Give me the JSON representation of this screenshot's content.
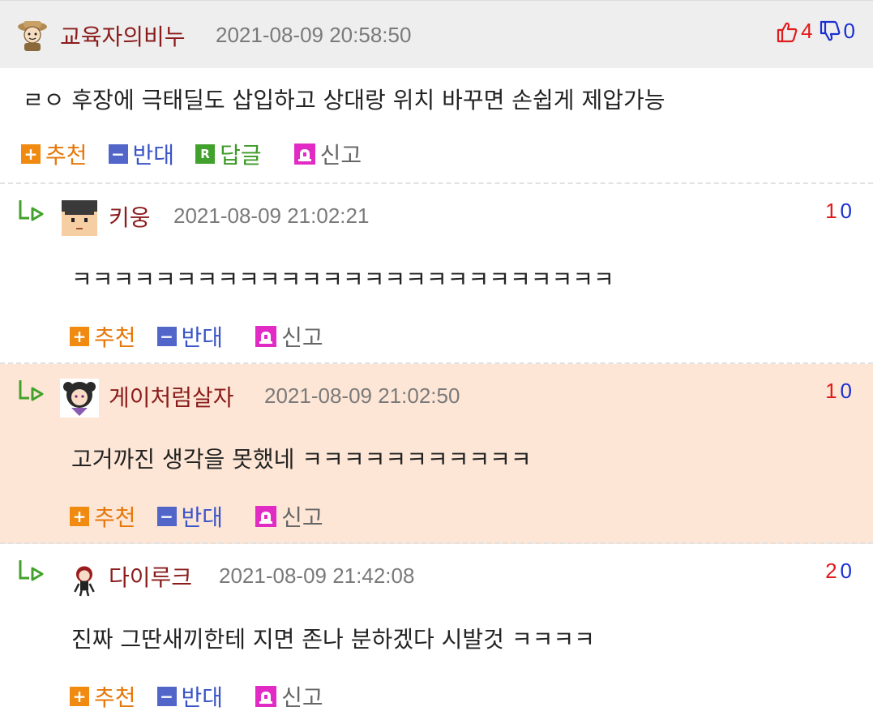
{
  "main_comment": {
    "nickname": "교육자의비누",
    "timestamp": "2021-08-09 20:58:50",
    "likes": "4",
    "dislikes": "0",
    "text": "ㄹㅇ 후장에 극태딜도 삽입하고 상대랑 위치 바꾸면 손쉽게 제압가능",
    "actions": {
      "recommend": "추천",
      "oppose": "반대",
      "reply": "답글",
      "report": "신고"
    }
  },
  "replies": [
    {
      "nickname": "키웅",
      "timestamp": "2021-08-09 21:02:21",
      "up": "1",
      "down": "0",
      "text": "ㅋㅋㅋㅋㅋㅋㅋㅋㅋㅋㅋㅋㅋㅋㅋㅋㅋㅋㅋㅋㅋㅋㅋㅋㅋㅋ",
      "actions": {
        "recommend": "추천",
        "oppose": "반대",
        "report": "신고"
      }
    },
    {
      "nickname": "게이처럼살자",
      "timestamp": "2021-08-09 21:02:50",
      "up": "1",
      "down": "0",
      "text": "고거까진 생각을 못했네 ㅋㅋㅋㅋㅋㅋㅋㅋㅋㅋㅋ",
      "actions": {
        "recommend": "추천",
        "oppose": "반대",
        "report": "신고"
      }
    },
    {
      "nickname": "다이루크",
      "timestamp": "2021-08-09 21:42:08",
      "up": "2",
      "down": "0",
      "text": "진짜 그딴새끼한테 지면 존나 분하겠다 시발것 ㅋㅋㅋㅋ",
      "actions": {
        "recommend": "추천",
        "oppose": "반대",
        "report": "신고"
      }
    }
  ],
  "icons": {
    "like": "thumbs-up-icon",
    "dislike": "thumbs-down-icon",
    "reply_arrow": "reply-arrow-icon",
    "report": "siren-icon"
  },
  "colors": {
    "nickname": "#8b1c1c",
    "recommend": "#e6780a",
    "oppose": "#3a55c6",
    "reply": "#3c9a26",
    "highlight_bg": "#fde6d6"
  }
}
